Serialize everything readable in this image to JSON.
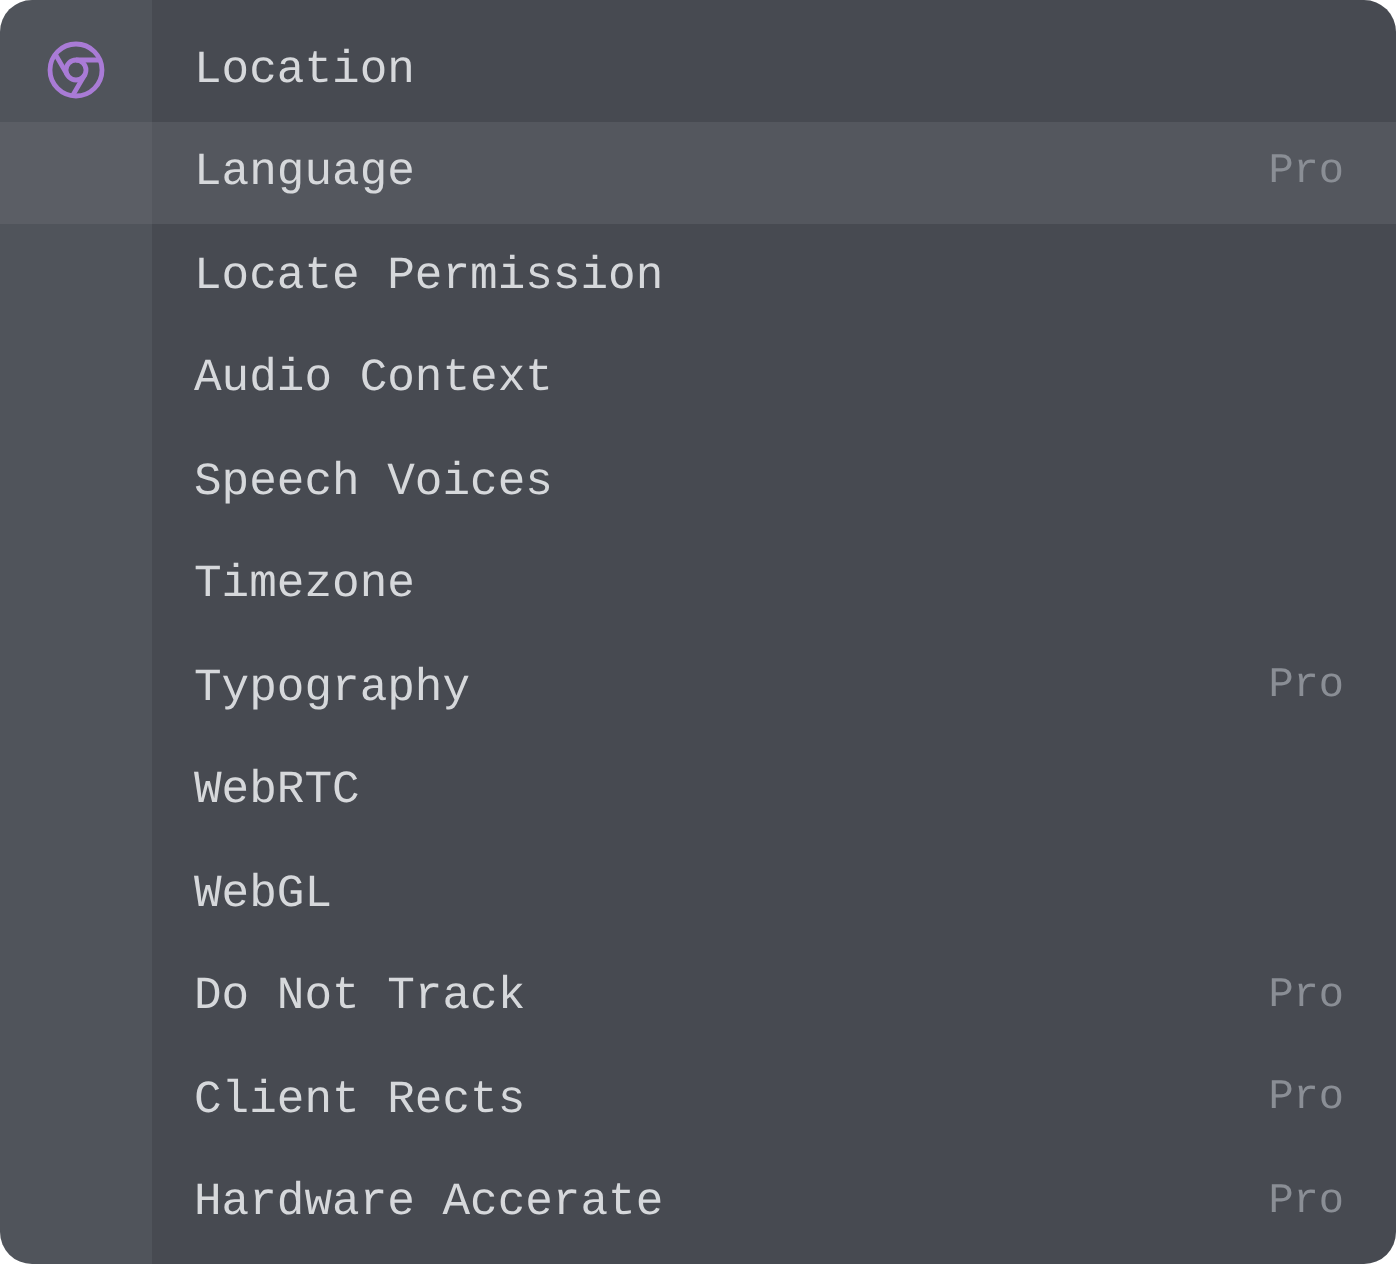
{
  "items": [
    {
      "label": "Location",
      "selected": false
    },
    {
      "label": "Language",
      "badge": "Pro",
      "selected": true
    },
    {
      "label": "Locate Permission",
      "selected": false
    },
    {
      "label": "Audio Context",
      "selected": false
    },
    {
      "label": "Speech Voices",
      "selected": false
    },
    {
      "label": "Timezone",
      "selected": false
    },
    {
      "label": "Typography",
      "badge": "Pro",
      "selected": false
    },
    {
      "label": "WebRTC",
      "selected": false
    },
    {
      "label": "WebGL",
      "selected": false
    },
    {
      "label": "Do Not Track",
      "badge": "Pro",
      "selected": false
    },
    {
      "label": "Client Rects",
      "badge": "Pro",
      "selected": false
    },
    {
      "label": "Hardware Accerate",
      "badge": "Pro",
      "selected": false
    }
  ]
}
